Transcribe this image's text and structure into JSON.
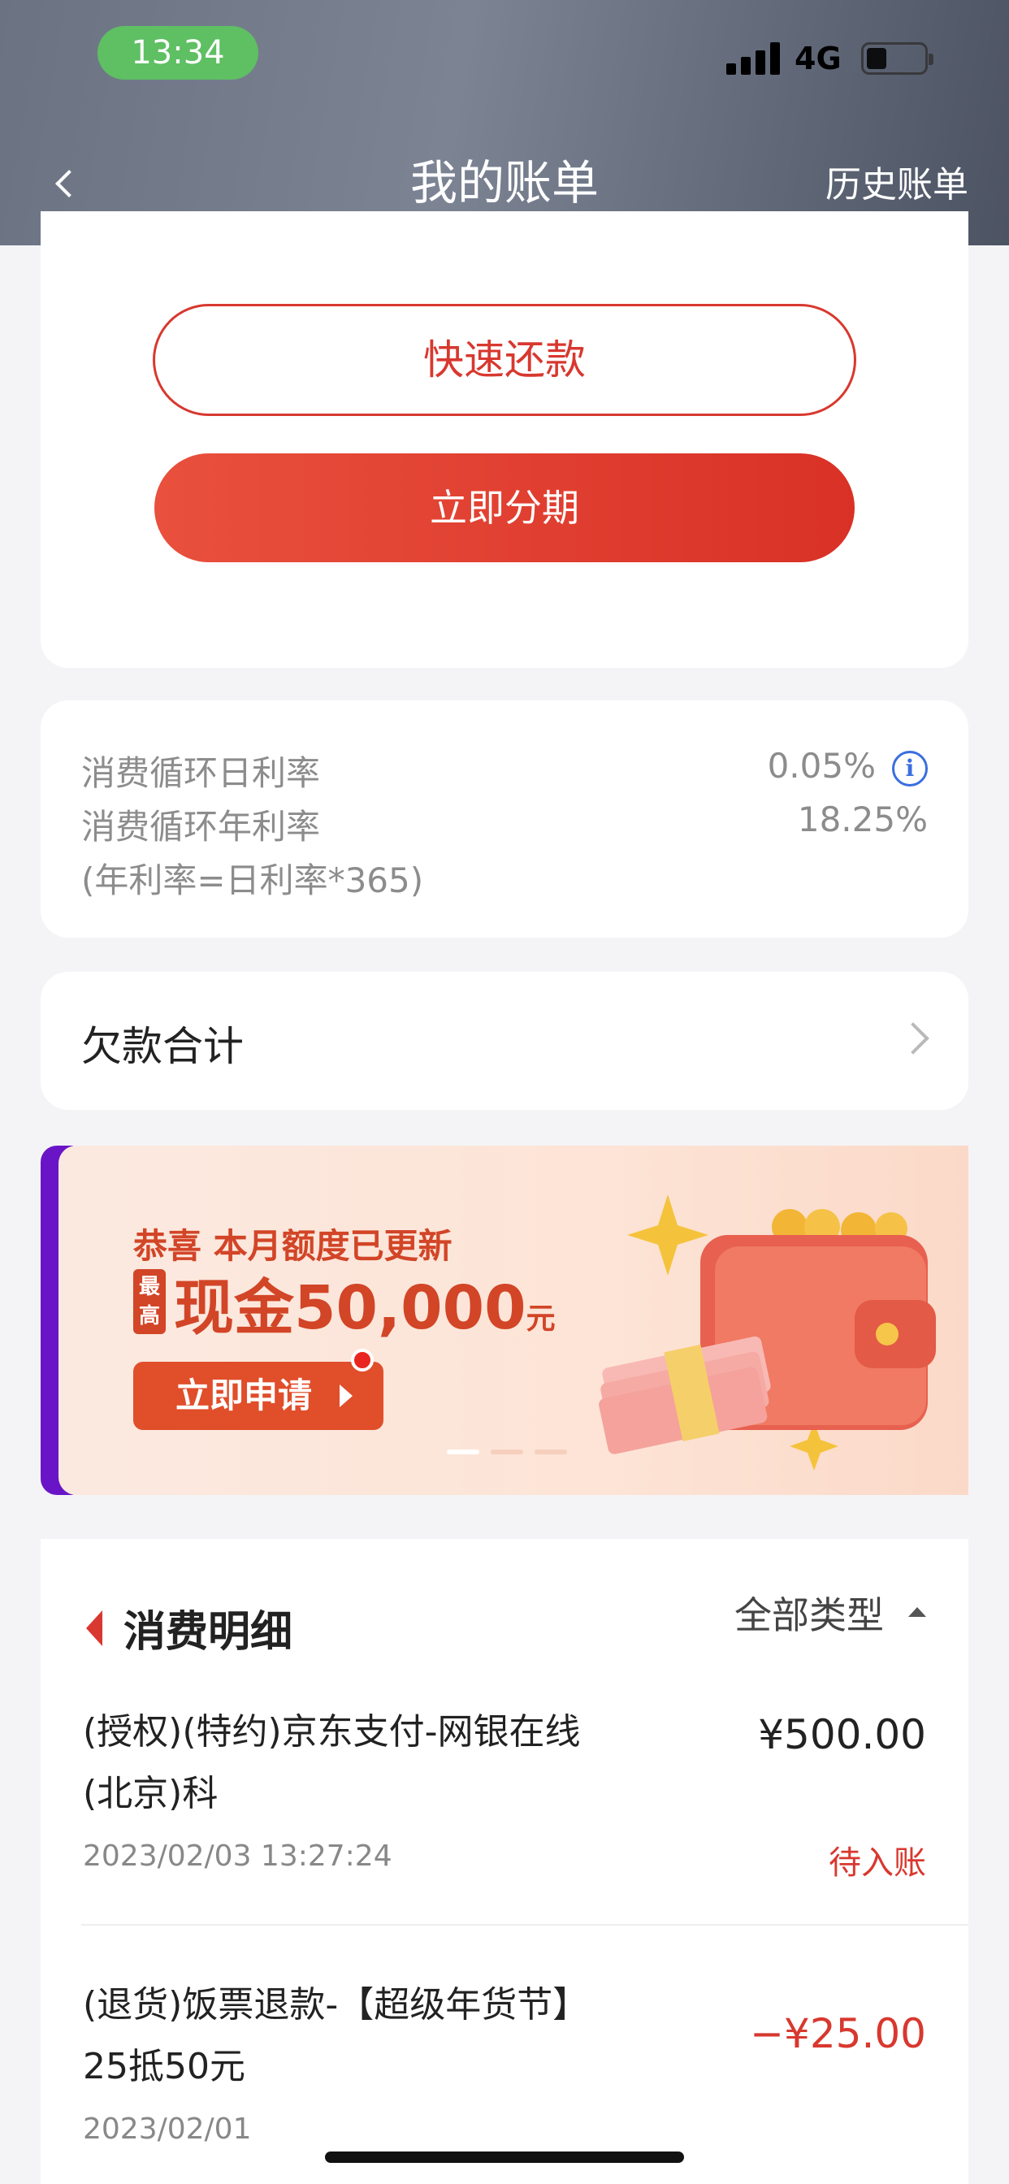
{
  "status_bar": {
    "time": "13:34",
    "network": "4G"
  },
  "header": {
    "title": "我的账单",
    "history_label": "历史账单"
  },
  "actions": {
    "quick_repay_label": "快速还款",
    "installment_label": "立即分期"
  },
  "rates": {
    "daily_label": "消费循环日利率",
    "daily_value": "0.05%",
    "annual_label": "消费循环年利率",
    "annual_value": "18.25%",
    "formula_note": "(年利率=日利率*365)"
  },
  "debt": {
    "label": "欠款合计"
  },
  "banner": {
    "line1": "恭喜 本月额度已更新",
    "badge": "最高",
    "cash_text": "现金50,000",
    "unit": "元",
    "apply_label": "立即申请",
    "slides": 3,
    "active_slide": 1
  },
  "details": {
    "title": "消费明细",
    "filter_label": "全部类型",
    "transactions": [
      {
        "desc": "(授权)(特约)京东支付-网银在线(北京)科",
        "amount": "¥500.00",
        "date": "2023/02/03 13:27:24",
        "status": "待入账"
      },
      {
        "desc": "(退货)饭票退款-【超级年货节】25抵50元",
        "amount": "−¥25.00",
        "date": "2023/02/01",
        "status": ""
      }
    ]
  },
  "colors": {
    "accent_red": "#d8382f",
    "banner_purple": "#6a14c7",
    "time_pill_green": "#5fbf63"
  }
}
